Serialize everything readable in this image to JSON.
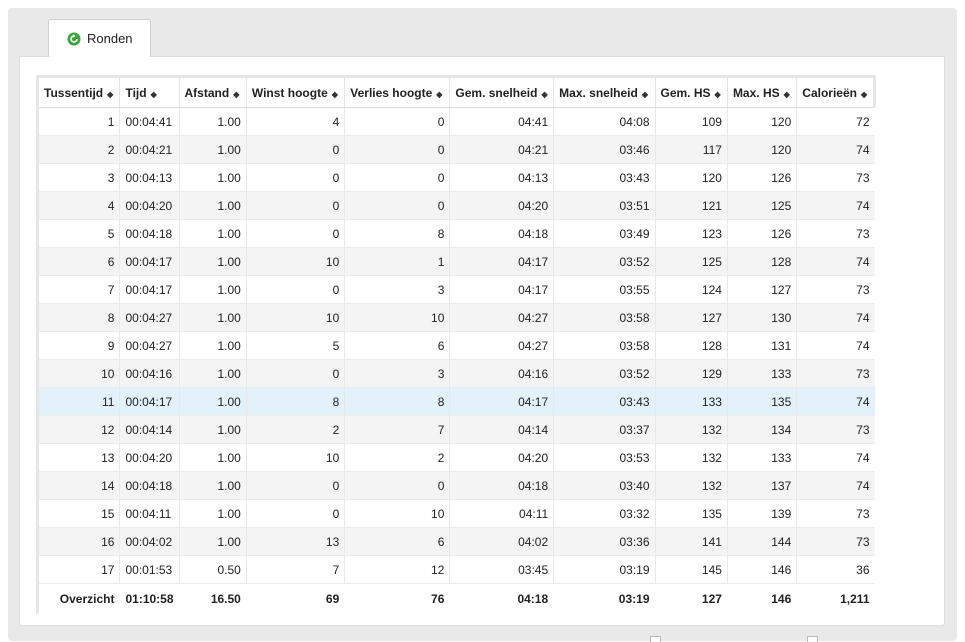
{
  "tab": {
    "label": "Ronden",
    "icon": "refresh-icon",
    "icon_color": "#3aa53a"
  },
  "columns": [
    "Tussentijd",
    "Tijd",
    "Afstand",
    "Winst hoogte",
    "Verlies hoogte",
    "Gem. snelheid",
    "Max. snelheid",
    "Gem. HS",
    "Max. HS",
    "Calorieën"
  ],
  "rows": [
    [
      "1",
      "00:04:41",
      "1.00",
      "4",
      "0",
      "04:41",
      "04:08",
      "109",
      "120",
      "72"
    ],
    [
      "2",
      "00:04:21",
      "1.00",
      "0",
      "0",
      "04:21",
      "03:46",
      "117",
      "120",
      "74"
    ],
    [
      "3",
      "00:04:13",
      "1.00",
      "0",
      "0",
      "04:13",
      "03:43",
      "120",
      "126",
      "73"
    ],
    [
      "4",
      "00:04:20",
      "1.00",
      "0",
      "0",
      "04:20",
      "03:51",
      "121",
      "125",
      "74"
    ],
    [
      "5",
      "00:04:18",
      "1.00",
      "0",
      "8",
      "04:18",
      "03:49",
      "123",
      "126",
      "73"
    ],
    [
      "6",
      "00:04:17",
      "1.00",
      "10",
      "1",
      "04:17",
      "03:52",
      "125",
      "128",
      "74"
    ],
    [
      "7",
      "00:04:17",
      "1.00",
      "0",
      "3",
      "04:17",
      "03:55",
      "124",
      "127",
      "73"
    ],
    [
      "8",
      "00:04:27",
      "1.00",
      "10",
      "10",
      "04:27",
      "03:58",
      "127",
      "130",
      "74"
    ],
    [
      "9",
      "00:04:27",
      "1.00",
      "5",
      "6",
      "04:27",
      "03:58",
      "128",
      "131",
      "74"
    ],
    [
      "10",
      "00:04:16",
      "1.00",
      "0",
      "3",
      "04:16",
      "03:52",
      "129",
      "133",
      "73"
    ],
    [
      "11",
      "00:04:17",
      "1.00",
      "8",
      "8",
      "04:17",
      "03:43",
      "133",
      "135",
      "74"
    ],
    [
      "12",
      "00:04:14",
      "1.00",
      "2",
      "7",
      "04:14",
      "03:37",
      "132",
      "134",
      "73"
    ],
    [
      "13",
      "00:04:20",
      "1.00",
      "10",
      "2",
      "04:20",
      "03:53",
      "132",
      "133",
      "74"
    ],
    [
      "14",
      "00:04:18",
      "1.00",
      "0",
      "0",
      "04:18",
      "03:40",
      "132",
      "137",
      "74"
    ],
    [
      "15",
      "00:04:11",
      "1.00",
      "0",
      "10",
      "04:11",
      "03:32",
      "135",
      "139",
      "73"
    ],
    [
      "16",
      "00:04:02",
      "1.00",
      "13",
      "6",
      "04:02",
      "03:36",
      "141",
      "144",
      "73"
    ],
    [
      "17",
      "00:01:53",
      "0.50",
      "7",
      "12",
      "03:45",
      "03:19",
      "145",
      "146",
      "36"
    ]
  ],
  "highlighted_row": 11,
  "summary": [
    "Overzicht",
    "01:10:58",
    "16.50",
    "69",
    "76",
    "04:18",
    "03:19",
    "127",
    "146",
    "1,211"
  ],
  "colors": {
    "highlight": "#e3f1fb",
    "stripe": "#f4f4f4",
    "frame": "#e9e9e9"
  }
}
